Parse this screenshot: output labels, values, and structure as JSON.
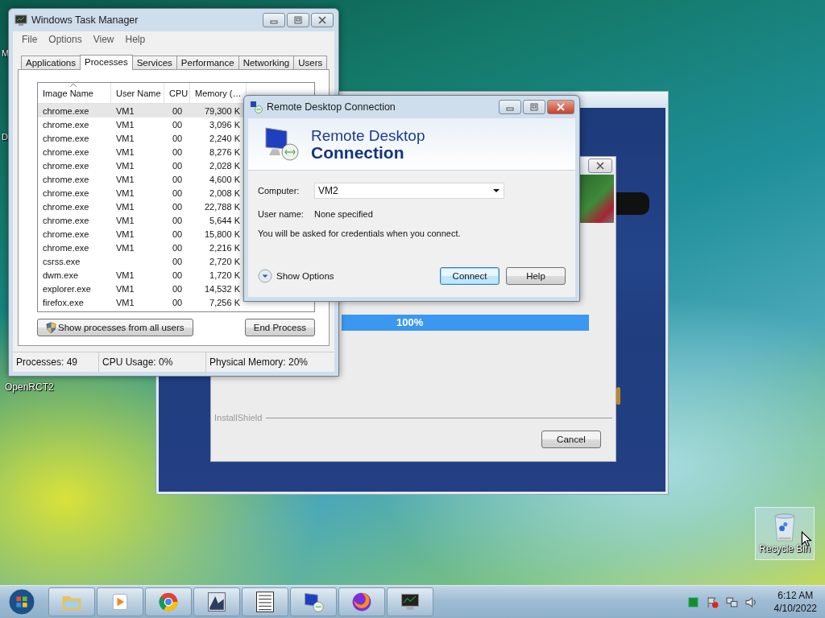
{
  "desktop_icons": [
    {
      "label": "M",
      "selected": false
    },
    {
      "label": "D",
      "selected": false
    },
    {
      "label": "OpenRCT2",
      "selected": false
    },
    {
      "label": "Recycle Bin",
      "selected": true
    }
  ],
  "installer": {
    "progress": {
      "level": 1,
      "reading": "100%"
    },
    "brand": "InstallShield",
    "cancel": "Cancel"
  },
  "task_manager": {
    "title": "Windows Task Manager",
    "menu": [
      "File",
      "Options",
      "View",
      "Help"
    ],
    "tabs": [
      {
        "label": "Applications",
        "selected": false
      },
      {
        "label": "Processes",
        "selected": true
      },
      {
        "label": "Services",
        "selected": false
      },
      {
        "label": "Performance",
        "selected": false
      },
      {
        "label": "Networking",
        "selected": false
      },
      {
        "label": "Users",
        "selected": false
      }
    ],
    "columns": [
      "Image Name",
      "User Name",
      "CPU",
      "Memory (…"
    ],
    "rows": [
      {
        "image_name": "chrome.exe",
        "user_name": "VM1",
        "cpu": "00",
        "memory": "79,300 K",
        "selected": true
      },
      {
        "image_name": "chrome.exe",
        "user_name": "VM1",
        "cpu": "00",
        "memory": "3,096 K",
        "selected": false
      },
      {
        "image_name": "chrome.exe",
        "user_name": "VM1",
        "cpu": "00",
        "memory": "2,240 K",
        "selected": false
      },
      {
        "image_name": "chrome.exe",
        "user_name": "VM1",
        "cpu": "00",
        "memory": "8,276 K",
        "selected": false
      },
      {
        "image_name": "chrome.exe",
        "user_name": "VM1",
        "cpu": "00",
        "memory": "2,028 K",
        "selected": false
      },
      {
        "image_name": "chrome.exe",
        "user_name": "VM1",
        "cpu": "00",
        "memory": "4,600 K",
        "selected": false
      },
      {
        "image_name": "chrome.exe",
        "user_name": "VM1",
        "cpu": "00",
        "memory": "2,008 K",
        "selected": false
      },
      {
        "image_name": "chrome.exe",
        "user_name": "VM1",
        "cpu": "00",
        "memory": "22,788 K",
        "selected": false
      },
      {
        "image_name": "chrome.exe",
        "user_name": "VM1",
        "cpu": "00",
        "memory": "5,644 K",
        "selected": false
      },
      {
        "image_name": "chrome.exe",
        "user_name": "VM1",
        "cpu": "00",
        "memory": "15,800 K",
        "selected": false
      },
      {
        "image_name": "chrome.exe",
        "user_name": "VM1",
        "cpu": "00",
        "memory": "2,216 K",
        "selected": false
      },
      {
        "image_name": "csrss.exe",
        "cpu": "00",
        "memory": "2,720 K",
        "selected": false
      },
      {
        "image_name": "dwm.exe",
        "user_name": "VM1",
        "cpu": "00",
        "memory": "1,720 K",
        "selected": false
      },
      {
        "image_name": "explorer.exe",
        "user_name": "VM1",
        "cpu": "00",
        "memory": "14,532 K",
        "selected": false
      },
      {
        "image_name": "firefox.exe",
        "user_name": "VM1",
        "cpu": "00",
        "memory": "7,256 K",
        "selected": false
      }
    ],
    "show_all_button": "Show processes from all users",
    "end_process_button": "End Process",
    "status_bar": [
      "Processes: 49",
      "CPU Usage: 0%",
      "Physical Memory: 20%"
    ]
  },
  "remote_desktop": {
    "title": "Remote Desktop Connection",
    "heading_line1": "Remote Desktop",
    "heading_line2": "Connection",
    "computer_label": "Computer:",
    "computer_value": "VM2",
    "user_label": "User name:",
    "user_value": "None specified",
    "note": "You will be asked for credentials when you connect.",
    "show_options": "Show Options",
    "connect_button": "Connect",
    "help_button": "Help"
  },
  "taskbar": {
    "apps": [
      {
        "kind": "folder"
      },
      {
        "kind": "player"
      },
      {
        "kind": "chrome"
      },
      {
        "kind": "viewer"
      },
      {
        "kind": "form"
      },
      {
        "kind": "remote"
      },
      {
        "kind": "fox"
      },
      {
        "kind": "monitor"
      }
    ],
    "clock": {
      "time": "6:12 AM",
      "date": "4/10/2022"
    }
  }
}
